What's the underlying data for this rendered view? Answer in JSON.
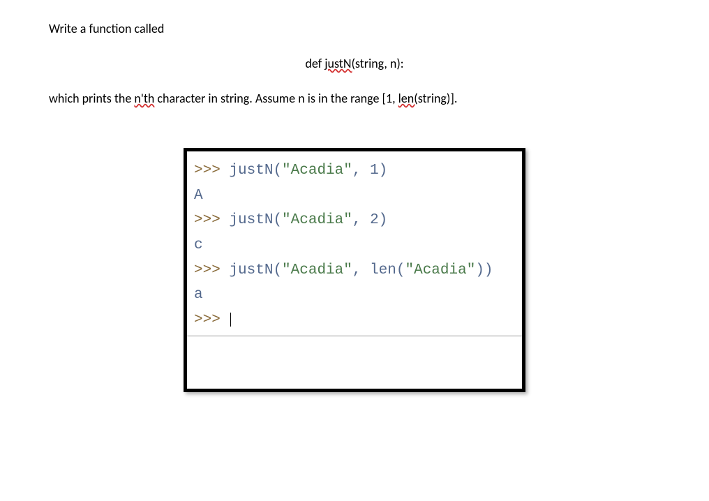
{
  "text": {
    "line1": "Write a function called",
    "line2_prefix": "def ",
    "line2_func": "justN(",
    "line2_suffix": "string, n):",
    "line3_prefix": "which prints the ",
    "line3_nth": "n'th",
    "line3_mid": " character in string. Assume n is in the range [1, ",
    "line3_len": "len(",
    "line3_suffix": "string)]."
  },
  "console": {
    "prompt": ">>>",
    "lines": [
      {
        "type": "input",
        "call": "justN",
        "args_prefix": "(",
        "str": "\"Acadia\"",
        "args_suffix": ", 1)"
      },
      {
        "type": "output",
        "text": "A"
      },
      {
        "type": "input",
        "call": "justN",
        "args_prefix": "(",
        "str": "\"Acadia\"",
        "args_suffix": ", 2)"
      },
      {
        "type": "output",
        "text": "c"
      },
      {
        "type": "input",
        "call": "justN",
        "args_prefix": "(",
        "str": "\"Acadia\"",
        "args_mid": ", len(",
        "str2": "\"Acadia\"",
        "args_suffix": "))"
      },
      {
        "type": "output",
        "text": "a"
      },
      {
        "type": "prompt_only"
      }
    ]
  }
}
